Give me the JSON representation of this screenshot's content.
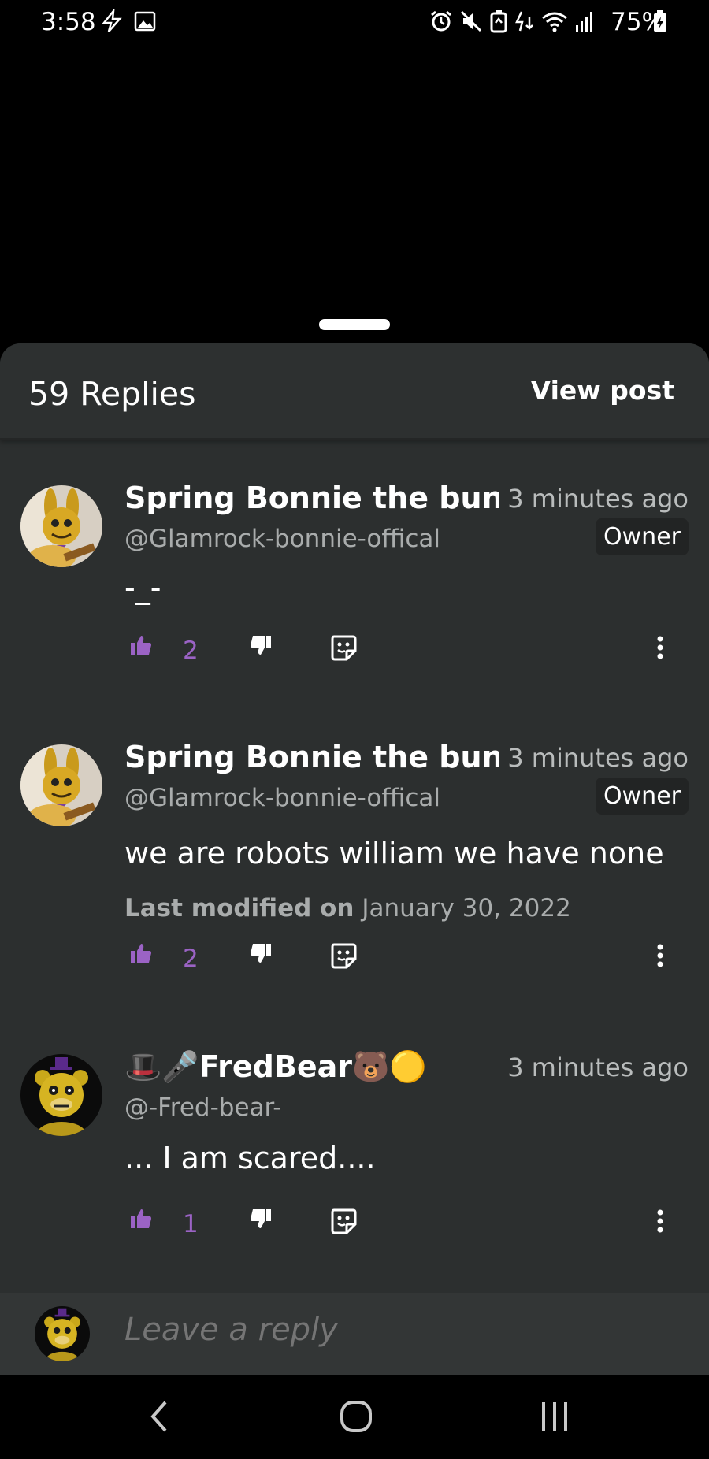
{
  "status_bar": {
    "time": "3:58",
    "battery": "75%",
    "icons": [
      "bolt-icon",
      "image-icon",
      "alarm-icon",
      "mute-icon",
      "battery-saver-icon",
      "data-icon",
      "wifi-icon",
      "signal-icon",
      "battery-icon"
    ]
  },
  "header": {
    "replies_count": "59 Replies",
    "view_post": "View post"
  },
  "replies": [
    {
      "author": "Spring Bonnie the bunny",
      "handle": "@Glamrock-bonnie-offical",
      "time": "3 minutes ago",
      "badge": "Owner",
      "body": "-_-",
      "likes": "2"
    },
    {
      "author": "Spring Bonnie the bunny",
      "handle": "@Glamrock-bonnie-offical",
      "time": "3 minutes ago",
      "badge": "Owner",
      "body": "we are robots william we have none",
      "modified_label": "Last modified on",
      "modified_date": "January 30, 2022",
      "likes": "2"
    },
    {
      "author": "🎩🎤FredBear🐻🟡",
      "handle": "@-Fred-bear-",
      "time": "3 minutes ago",
      "body": "... I am scared....",
      "likes": "1"
    }
  ],
  "composer": {
    "placeholder": "Leave a reply"
  },
  "colors": {
    "accent": "#9b63c5",
    "sheet_bg": "#2c2f2f"
  }
}
